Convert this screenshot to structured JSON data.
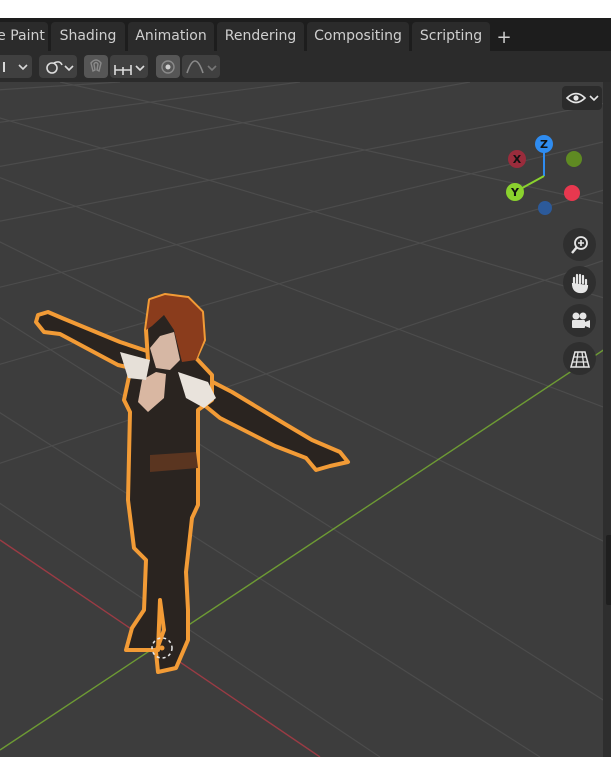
{
  "workspace_tabs": [
    {
      "label": "e Paint"
    },
    {
      "label": "Shading"
    },
    {
      "label": "Animation"
    },
    {
      "label": "Rendering"
    },
    {
      "label": "Compositing"
    },
    {
      "label": "Scripting"
    }
  ],
  "add_tab_label": "+",
  "gizmo": {
    "x_label": "X",
    "y_label": "Y",
    "z_label": "Z",
    "colors": {
      "x": "#e8384f",
      "y": "#8ad22e",
      "z": "#2f8cf0",
      "neg_x": "#9a2c3c",
      "neg_y": "#5f8a22",
      "neg_z": "#2c5a9a"
    }
  },
  "icons": {
    "toolbar": [
      "mode-dropdown-icon",
      "link-icon",
      "snap-magnet-icon",
      "snap-increment-icon",
      "proportional-edit-icon",
      "falloff-curve-icon"
    ],
    "navigation": [
      "zoom-icon",
      "pan-hand-icon",
      "camera-icon",
      "ortho-grid-icon"
    ],
    "overlay": [
      "eye-visibility-icon"
    ]
  },
  "colors": {
    "viewport_background": "#3d3d3d",
    "x_axis_line": "#9a3b44",
    "y_axis_line": "#6d9a34",
    "selection_outline": "#f29b36"
  }
}
